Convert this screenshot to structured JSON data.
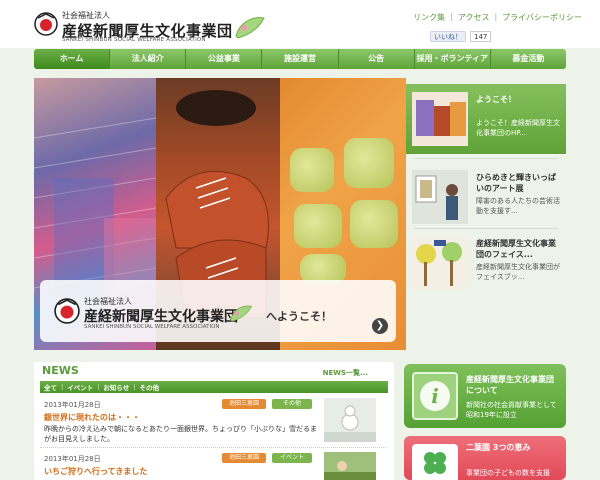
{
  "header": {
    "logo_small": "社会福祉法人",
    "logo_name": "産経新聞厚生文化事業団",
    "logo_en": "SANKEI SHINBUN SOCIAL WELFARE ASSOCIATION",
    "links": [
      "リンク集",
      "アクセス",
      "プライバシーポリシー"
    ],
    "like_label": "いいね！",
    "like_count": "147"
  },
  "nav": {
    "items": [
      "ホーム",
      "法人紹介",
      "公益事業",
      "施設運営",
      "公告",
      "採用・ボランティア",
      "募金活動"
    ]
  },
  "hero": {
    "overlay_small": "社会福祉法人",
    "overlay_name": "産経新聞厚生文化事業団",
    "overlay_en": "SANKEI SHINBUN SOCIAL WELFARE ASSOCIATION",
    "welcome": "へようこそ！",
    "arrow": "❯"
  },
  "side_list": [
    {
      "title": "ようこそ！",
      "desc": "ようこそ！産経新聞厚生文化事業団のHP..."
    },
    {
      "title": "ひらめきと輝きいっぱいのアート展",
      "desc": "障害のある人たちの芸術活動を支援す..."
    },
    {
      "title": "産経新聞厚生文化事業団のフェイス...",
      "desc": "産経新聞厚生文化事業団がフェイスブッ..."
    }
  ],
  "news": {
    "title": "NEWS",
    "more": "NEWS一覧...",
    "tabs": [
      "全て",
      "イベント",
      "お知らせ",
      "その他"
    ],
    "items": [
      {
        "date": "2013年01月28日",
        "org": "池田三恵園",
        "category": "その他",
        "title": "銀世界に現れたのは・・・",
        "text": "昨晩からの冷え込みで朝になるとあたり一面銀世界。ちょっぴり「小ぶりな」雪だるまがお目見えしました。"
      },
      {
        "date": "2013年01月28日",
        "org": "池田三恵園",
        "category": "イベント",
        "title": "いちご狩りへ行ってきました",
        "text": ""
      }
    ]
  },
  "cards": {
    "about_title": "産経新聞厚生文化事業団について",
    "about_desc": "新聞社の社会貢献事業として昭和19年に設立",
    "about_icon": "i",
    "garden_title": "二葉園 3つの恵み",
    "garden_desc": "事業団の子どもの数を支援"
  },
  "colors": {
    "accent_green": "#5fa33a",
    "news_orange": "#d46a13",
    "card_red": "#e24a58"
  }
}
